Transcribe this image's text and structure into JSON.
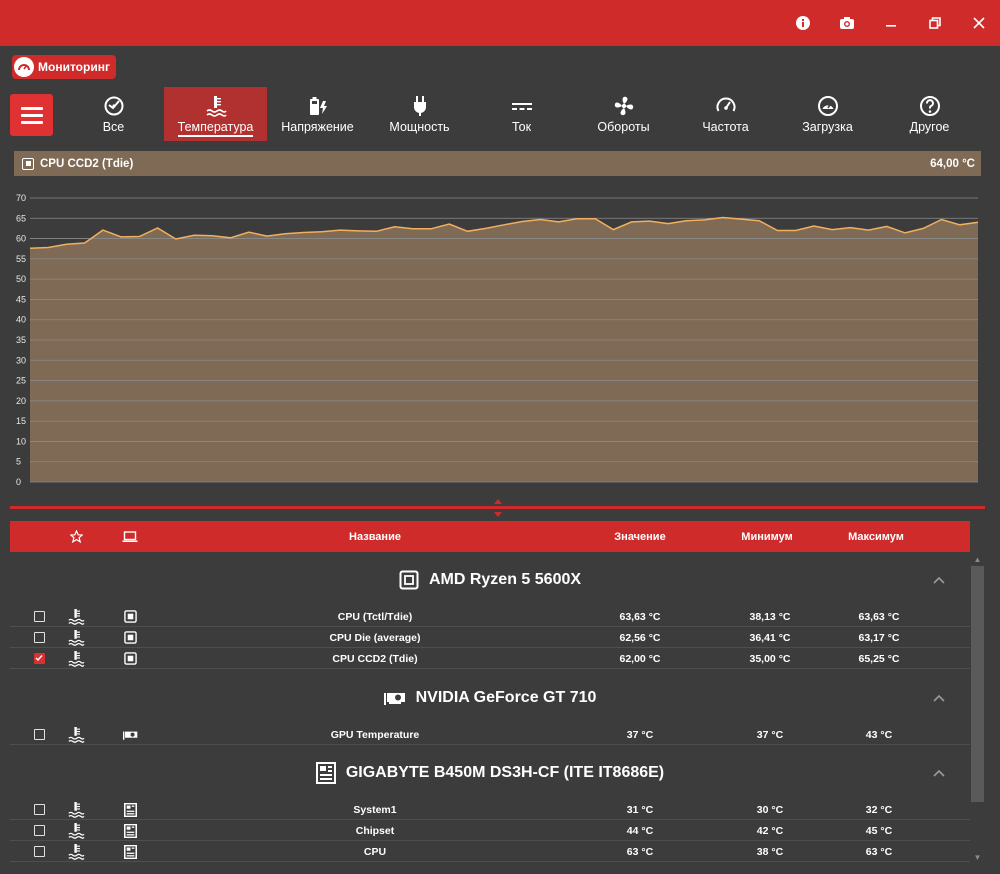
{
  "app": {
    "badge_label": "Мониторинг"
  },
  "tabs": [
    {
      "label": "Все",
      "icon": "all-sensors-icon"
    },
    {
      "label": "Температура",
      "icon": "thermometer-icon",
      "active": true
    },
    {
      "label": "Напряжение",
      "icon": "battery-bolt-icon"
    },
    {
      "label": "Мощность",
      "icon": "plug-icon"
    },
    {
      "label": "Ток",
      "icon": "current-icon"
    },
    {
      "label": "Обороты",
      "icon": "fan-icon"
    },
    {
      "label": "Частота",
      "icon": "speedometer-icon"
    },
    {
      "label": "Загрузка",
      "icon": "gauge-icon"
    },
    {
      "label": "Другое",
      "icon": "question-icon"
    }
  ],
  "chart_header": {
    "sensor": "CPU CCD2 (Tdie)",
    "value": "64,00 °C"
  },
  "chart_data": {
    "type": "area",
    "ylim": [
      0,
      70
    ],
    "y_ticks": [
      "70",
      "65",
      "60",
      "55",
      "50",
      "45",
      "40",
      "35",
      "30",
      "25",
      "20",
      "15",
      "10",
      "5",
      "0"
    ],
    "grid": true,
    "line_color": "#f0b060",
    "fill_color": "#7f6a55",
    "values": [
      57.6,
      57.8,
      58.6,
      58.9,
      62.1,
      60.4,
      60.5,
      62.6,
      59.9,
      60.8,
      60.7,
      60.2,
      61.6,
      60.6,
      61.2,
      61.5,
      61.7,
      62.1,
      61.9,
      61.8,
      62.9,
      62.4,
      62.4,
      63.6,
      61.8,
      62.5,
      63.4,
      64.2,
      64.7,
      64.1,
      64.9,
      64.9,
      62.2,
      64.1,
      64.3,
      63.7,
      64.4,
      64.6,
      65.2,
      64.8,
      64.4,
      62.0,
      62.0,
      63.1,
      62.2,
      62.7,
      62.1,
      63.0,
      61.4,
      62.5,
      64.7,
      63.4,
      64.0
    ]
  },
  "table": {
    "headers": {
      "name": "Название",
      "value": "Значение",
      "min": "Минимум",
      "max": "Максимум"
    },
    "groups": [
      {
        "title": "AMD Ryzen 5 5600X",
        "icon": "cpu-chip-icon",
        "rows": [
          {
            "name": "CPU (Tctl/Tdie)",
            "value": "63,63 °C",
            "min": "38,13 °C",
            "max": "63,63 °C",
            "checked": false
          },
          {
            "name": "CPU Die (average)",
            "value": "62,56 °C",
            "min": "36,41 °C",
            "max": "63,17 °C",
            "checked": false
          },
          {
            "name": "CPU CCD2 (Tdie)",
            "value": "62,00 °C",
            "min": "35,00 °C",
            "max": "65,25 °C",
            "checked": true
          }
        ]
      },
      {
        "title": "NVIDIA GeForce GT 710",
        "icon": "gpu-card-icon",
        "rows": [
          {
            "name": "GPU Temperature",
            "value": "37 °C",
            "min": "37 °C",
            "max": "43 °C",
            "checked": false
          }
        ]
      },
      {
        "title": "GIGABYTE B450M DS3H-CF (ITE IT8686E)",
        "icon": "motherboard-icon",
        "rows": [
          {
            "name": "System1",
            "value": "31 °C",
            "min": "30 °C",
            "max": "32 °C",
            "checked": false
          },
          {
            "name": "Chipset",
            "value": "44 °C",
            "min": "42 °C",
            "max": "45 °C",
            "checked": false
          },
          {
            "name": "CPU",
            "value": "63 °C",
            "min": "38 °C",
            "max": "63 °C",
            "checked": false
          }
        ]
      }
    ]
  }
}
